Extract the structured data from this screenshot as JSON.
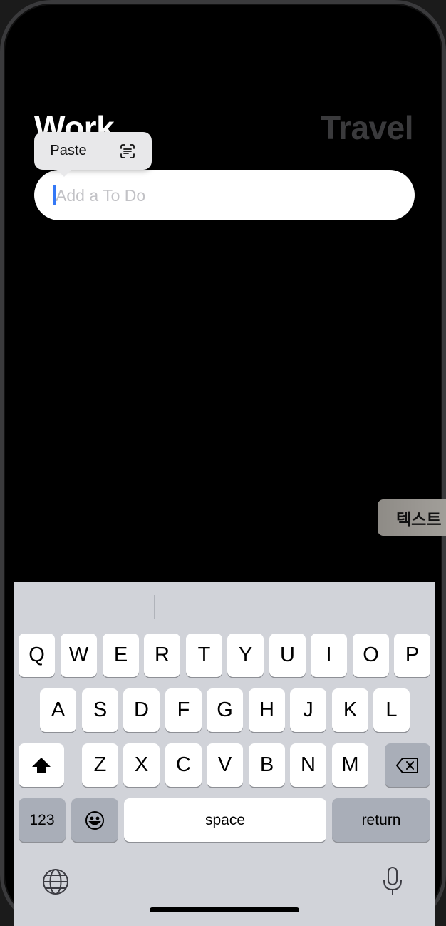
{
  "header": {
    "tab_work": "Work",
    "tab_travel": "Travel"
  },
  "todo_input": {
    "placeholder": "Add a To Do",
    "value": ""
  },
  "edit_menu": {
    "paste_label": "Paste",
    "scan_icon": "scan-text-icon"
  },
  "side_pill": {
    "label": "텍스트"
  },
  "keyboard": {
    "row1": [
      "Q",
      "W",
      "E",
      "R",
      "T",
      "Y",
      "U",
      "I",
      "O",
      "P"
    ],
    "row2": [
      "A",
      "S",
      "D",
      "F",
      "G",
      "H",
      "J",
      "K",
      "L"
    ],
    "row3": [
      "Z",
      "X",
      "C",
      "V",
      "B",
      "N",
      "M"
    ],
    "numbers_label": "123",
    "space_label": "space",
    "return_label": "return",
    "shift_icon": "shift-icon",
    "delete_icon": "delete-icon",
    "emoji_icon": "emoji-icon",
    "globe_icon": "globe-icon",
    "mic_icon": "microphone-icon"
  },
  "colors": {
    "background": "#000000",
    "tab_active": "#ffffff",
    "tab_inactive": "#3a3a3c",
    "caret": "#3478f6",
    "keyboard_bg": "#d1d3d9"
  }
}
